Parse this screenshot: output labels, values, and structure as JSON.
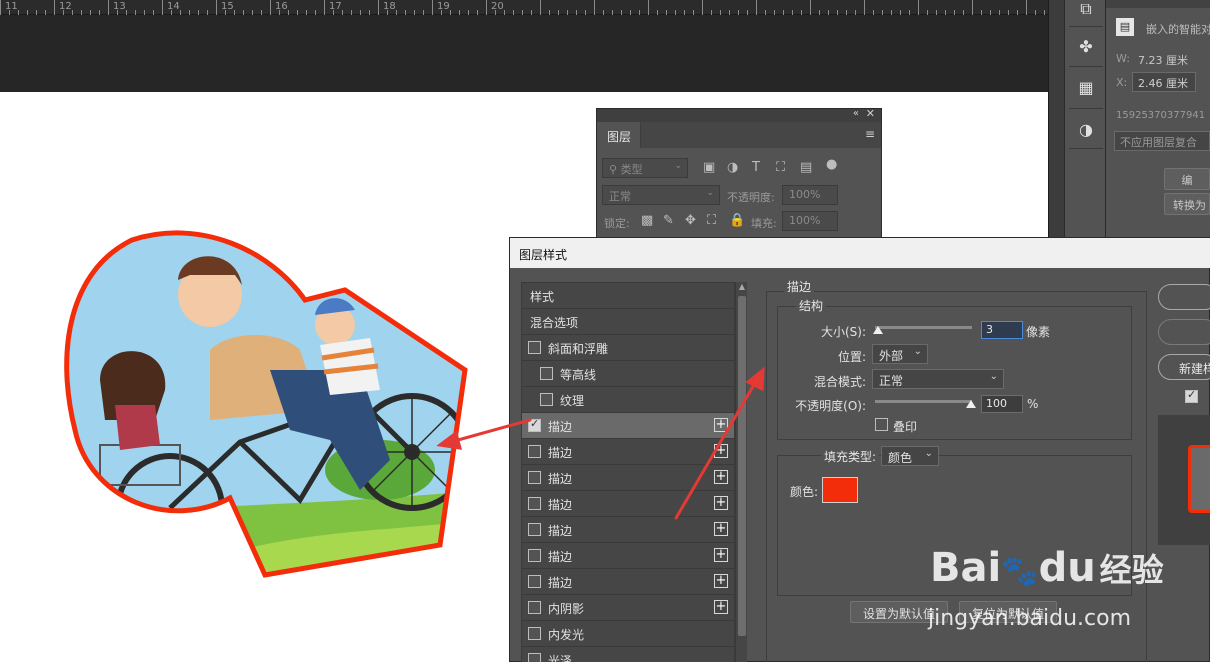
{
  "ruler": {
    "numbers": [
      "11",
      "12",
      "13",
      "14",
      "15",
      "16",
      "17",
      "18",
      "19",
      "20"
    ]
  },
  "properties": {
    "header_text": "嵌入的智能对",
    "w_label": "W:",
    "w_value": "7.23 厘米",
    "x_label": "X:",
    "x_value": "2.46 厘米",
    "file_id": "15925370377941",
    "button_no_comp": "不应用图层复合",
    "button_edit": "编",
    "button_convert": "转换为"
  },
  "layers_panel": {
    "tab_label": "图层",
    "filter_kind": "类型",
    "blend_mode": "正常",
    "opacity_label": "不透明度:",
    "opacity_value": "100%",
    "lock_label": "锁定:",
    "fill_label": "填充:",
    "fill_value": "100%"
  },
  "layer_style_dialog": {
    "title": "图层样式",
    "style_items": [
      {
        "label": "样式"
      },
      {
        "label": "混合选项"
      },
      {
        "label": "斜面和浮雕",
        "checked": false
      },
      {
        "label": "等高线",
        "checked": false
      },
      {
        "label": "纹理",
        "checked": false
      },
      {
        "label": "描边",
        "checked": true,
        "selected": true
      },
      {
        "label": "描边",
        "checked": false
      },
      {
        "label": "描边",
        "checked": false
      },
      {
        "label": "描边",
        "checked": false
      },
      {
        "label": "描边",
        "checked": false
      },
      {
        "label": "描边",
        "checked": false
      },
      {
        "label": "描边",
        "checked": false
      },
      {
        "label": "内阴影",
        "checked": false
      },
      {
        "label": "内发光",
        "checked": false
      },
      {
        "label": "光泽",
        "checked": false
      }
    ],
    "stroke": {
      "section_title": "描边",
      "structure_title": "结构",
      "size_label": "大小(S):",
      "size_value": "3",
      "size_unit": "像素",
      "position_label": "位置:",
      "position_value": "外部",
      "blend_label": "混合模式:",
      "blend_value": "正常",
      "opacity_label": "不透明度(O):",
      "opacity_value": "100",
      "opacity_unit": "%",
      "overprint_label": "叠印",
      "fill_type_label": "填充类型:",
      "fill_type_value": "颜色",
      "color_label": "颜色:",
      "color_value": "#f32c0a"
    },
    "buttons": {
      "set_default": "设置为默认值",
      "reset_default": "复位为默认值",
      "new_style": "新建样"
    }
  },
  "watermark": {
    "brand": "Bai",
    "brand_du": "du",
    "brand_cn": "经验",
    "url": "jingyan.baidu.com"
  },
  "colors": {
    "stroke_red": "#f32c0a",
    "annotation_arrow": "#e53935"
  }
}
